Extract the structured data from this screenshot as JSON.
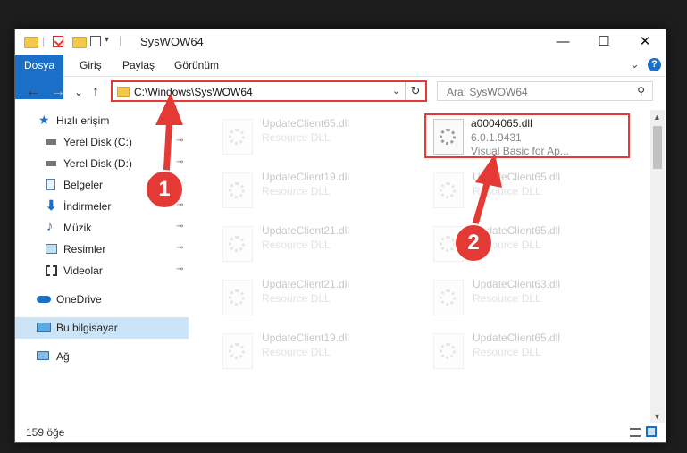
{
  "window": {
    "title": "SysWOW64",
    "minimize": "—",
    "maximize": "☐",
    "close": "✕"
  },
  "ribbon": {
    "tabs": [
      "Dosya",
      "Giriş",
      "Paylaş",
      "Görünüm"
    ],
    "expand": "⌄",
    "help": "?"
  },
  "nav": {
    "back": "←",
    "forward": "→",
    "recent": "⌄",
    "up": "↑"
  },
  "address": {
    "path": "C:\\Windows\\SysWOW64",
    "dropdown": "⌄",
    "refresh": "↻"
  },
  "search": {
    "placeholder": "Ara: SysWOW64",
    "icon": "search-icon"
  },
  "sidebar": {
    "items": [
      {
        "label": "Hızlı erişim",
        "icon": "star-icon",
        "pinned": false
      },
      {
        "label": "Yerel Disk (C:)",
        "icon": "drive-icon",
        "pinned": true
      },
      {
        "label": "Yerel Disk (D:)",
        "icon": "drive-icon",
        "pinned": true
      },
      {
        "label": "Belgeler",
        "icon": "document-icon",
        "pinned": true
      },
      {
        "label": "İndirmeler",
        "icon": "download-icon",
        "pinned": true
      },
      {
        "label": "Müzik",
        "icon": "music-icon",
        "pinned": true
      },
      {
        "label": "Resimler",
        "icon": "pictures-icon",
        "pinned": true
      },
      {
        "label": "Videolar",
        "icon": "video-icon",
        "pinned": true
      },
      {
        "label": "OneDrive",
        "icon": "cloud-icon",
        "pinned": false
      },
      {
        "label": "Bu bilgisayar",
        "icon": "computer-icon",
        "pinned": false,
        "selected": true
      },
      {
        "label": "Ağ",
        "icon": "network-icon",
        "pinned": false
      }
    ],
    "pin_glyph": "📌"
  },
  "files": {
    "left": [
      {
        "name": "UpdateClient65.dll",
        "type": "Resource DLL"
      },
      {
        "name": "UpdateClient19.dll",
        "type": "Resource DLL"
      },
      {
        "name": "UpdateClient21.dll",
        "type": "Resource DLL"
      },
      {
        "name": "UpdateClient21.dll",
        "type": "Resource DLL"
      },
      {
        "name": "UpdateClient19.dll",
        "type": "Resource DLL"
      }
    ],
    "right": [
      {
        "name": "a0004065.dll",
        "type": "6.0.1.9431",
        "desc": "Visual Basic for Ap...",
        "highlighted": true
      },
      {
        "name": "UpdateClient65.dll",
        "type": "Resource DLL"
      },
      {
        "name": "UpdateClient65.dll",
        "type": "Resource DLL"
      },
      {
        "name": "UpdateClient63.dll",
        "type": "Resource DLL"
      },
      {
        "name": "UpdateClient65.dll",
        "type": "Resource DLL"
      }
    ]
  },
  "status": {
    "count": "159 öğe"
  },
  "annotations": {
    "one": "1",
    "two": "2"
  },
  "colors": {
    "accent": "#1a6fc9",
    "highlight": "#e53935",
    "selected": "#cce4f7"
  }
}
